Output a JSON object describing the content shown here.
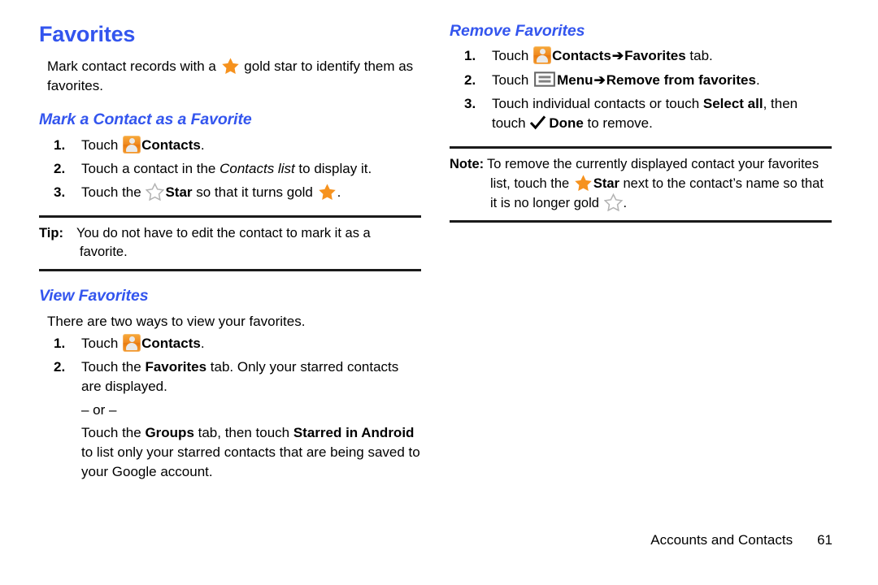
{
  "page": {
    "footer_label": "Accounts and Contacts",
    "footer_page_number": "61"
  },
  "colors": {
    "heading_blue": "#3355ee",
    "gold_star": "#f6921e",
    "empty_star_outline": "#b3b3b3",
    "icon_orange": "#f08a20",
    "rule_black": "#1a1a1a"
  },
  "left_column": {
    "title": "Favorites",
    "intro": {
      "before_star": "Mark contact records with a ",
      "after_star": " gold star to identify them as favorites."
    },
    "mark_section": {
      "heading": "Mark a Contact as a Favorite",
      "steps": [
        {
          "num": "1.",
          "t1": "Touch ",
          "t2": "Contacts",
          "t3": "."
        },
        {
          "num": "2.",
          "t1": "Touch a contact in the ",
          "t2": "Contacts list",
          "t3": " to display it."
        },
        {
          "num": "3.",
          "t1": "Touch the ",
          "t2": "Star",
          "t3": " so that it turns gold ",
          "t4": "."
        }
      ]
    },
    "tip": {
      "label": "Tip:",
      "text": "You do not have to edit the contact to mark it as a favorite."
    },
    "view_section": {
      "heading": "View Favorites",
      "intro": "There are two ways to view your favorites.",
      "steps": [
        {
          "num": "1.",
          "t1": "Touch ",
          "t2": "Contacts",
          "t3": "."
        },
        {
          "num": "2.",
          "t1": "Touch the ",
          "t2": "Favorites",
          "t3": " tab. Only your starred contacts are displayed."
        }
      ],
      "or_separator": "– or –",
      "alt_step": {
        "t1": "Touch the ",
        "t2": "Groups",
        "t3": " tab, then touch ",
        "t4": "Starred in Android",
        "t5": " to list only your starred contacts that are being saved to your Google account."
      }
    }
  },
  "right_column": {
    "remove_section": {
      "heading": "Remove Favorites",
      "steps": [
        {
          "num": "1.",
          "t1": "Touch ",
          "t2": "Contacts",
          "arrow": "➔",
          "t3": "Favorites",
          "t4": " tab."
        },
        {
          "num": "2.",
          "t1": "Touch ",
          "t2": "Menu",
          "arrow": "➔",
          "t3": "Remove from favorites",
          "t4": "."
        },
        {
          "num": "3.",
          "t1": "Touch individual contacts or touch ",
          "t2": "Select all",
          "t3": ", then touch ",
          "t4": "Done",
          "t5": " to remove."
        }
      ]
    },
    "note": {
      "label": "Note:",
      "t1": "To remove the currently displayed contact your favorites list, touch the ",
      "t2": "Star",
      "t3": " next to the contact’s name so that it is no longer gold ",
      "t4": "."
    }
  },
  "icons": {
    "contacts": "contacts-icon",
    "gold_star": "gold-star-icon",
    "empty_star": "empty-star-icon",
    "menu": "menu-icon",
    "check": "check-icon"
  }
}
